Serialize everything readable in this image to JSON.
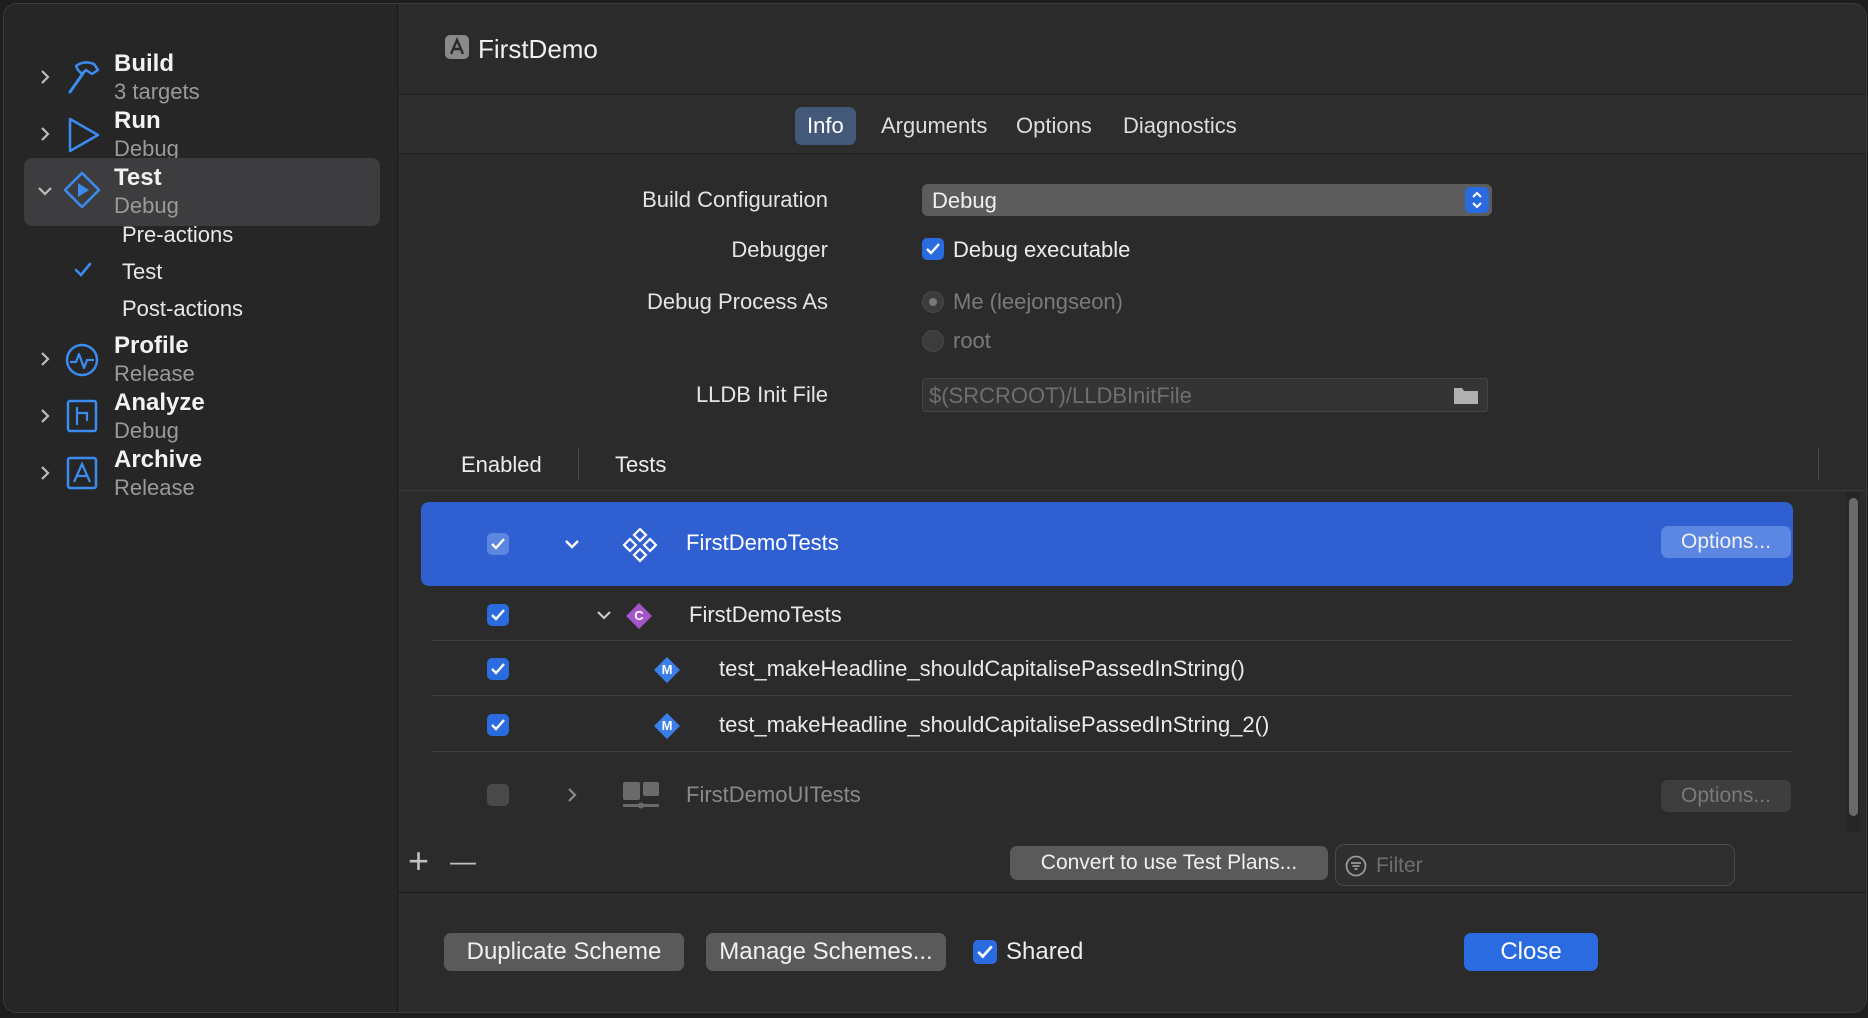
{
  "sidebar": {
    "actions": [
      {
        "name": "Build",
        "sub": "3 targets",
        "icon": "hammer-icon"
      },
      {
        "name": "Run",
        "sub": "Debug",
        "icon": "play-icon"
      },
      {
        "name": "Test",
        "sub": "Debug",
        "icon": "test-diamond-icon"
      },
      {
        "name": "Profile",
        "sub": "Release",
        "icon": "gauge-icon"
      },
      {
        "name": "Analyze",
        "sub": "Debug",
        "icon": "analyze-icon"
      },
      {
        "name": "Archive",
        "sub": "Release",
        "icon": "archive-icon"
      }
    ],
    "test_subitems": [
      "Pre-actions",
      "Test",
      "Post-actions"
    ]
  },
  "header": {
    "title": "FirstDemo"
  },
  "tabs": [
    "Info",
    "Arguments",
    "Options",
    "Diagnostics"
  ],
  "form": {
    "build_config_label": "Build Configuration",
    "build_config_value": "Debug",
    "debugger_label": "Debugger",
    "debugger_value": "Debug executable",
    "debug_as_label": "Debug Process As",
    "debug_as_me": "Me (leejongseon)",
    "debug_as_root": "root",
    "lldb_label": "LLDB Init File",
    "lldb_placeholder": "$(SRCROOT)/LLDBInitFile"
  },
  "table": {
    "col_enabled": "Enabled",
    "col_tests": "Tests",
    "rows": [
      {
        "name": "FirstDemoTests",
        "button": "Options..."
      },
      {
        "name": "FirstDemoTests",
        "badge": "C"
      },
      {
        "name": "test_makeHeadline_shouldCapitalisePassedInString()",
        "badge": "M"
      },
      {
        "name": "test_makeHeadline_shouldCapitalisePassedInString_2()",
        "badge": "M"
      },
      {
        "name": "FirstDemoUITests",
        "button": "Options..."
      }
    ]
  },
  "toolbar": {
    "add": "+",
    "remove": "—",
    "convert": "Convert to use Test Plans...",
    "filter_placeholder": "Filter"
  },
  "footer": {
    "duplicate": "Duplicate Scheme",
    "manage": "Manage Schemes...",
    "shared": "Shared",
    "close": "Close"
  },
  "colors": {
    "accent": "#2a6cdf",
    "selection": "#2f5fd0",
    "icon_blue": "#3b8cf0",
    "class_badge": "#a455c8"
  }
}
